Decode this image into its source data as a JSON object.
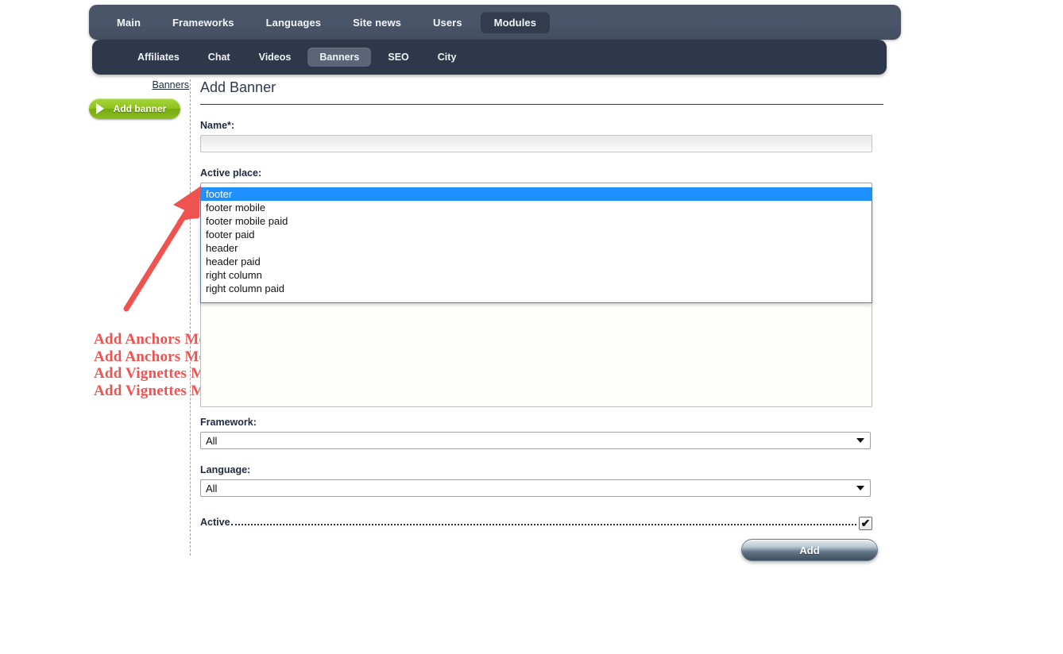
{
  "nav": {
    "primary": [
      {
        "label": "Main",
        "active": false
      },
      {
        "label": "Frameworks",
        "active": false
      },
      {
        "label": "Languages",
        "active": false
      },
      {
        "label": "Site news",
        "active": false
      },
      {
        "label": "Users",
        "active": false
      },
      {
        "label": "Modules",
        "active": true
      }
    ],
    "secondary": [
      {
        "label": "Affiliates",
        "active": false
      },
      {
        "label": "Chat",
        "active": false
      },
      {
        "label": "Videos",
        "active": false
      },
      {
        "label": "Banners",
        "active": true
      },
      {
        "label": "SEO",
        "active": false
      },
      {
        "label": "City",
        "active": false
      }
    ]
  },
  "sidebar": {
    "breadcrumb_label": "Banners",
    "add_banner_label": "Add banner",
    "add_banner_icon": "play-triangle-icon",
    "annotations": [
      "Add Anchors Mobil",
      "Add Anchors Mobil Paid",
      "Add Vignettes Mobil",
      "Add Vignettes Mobil Paid"
    ],
    "annotation_color": "#ef5350"
  },
  "main": {
    "title": "Add Banner",
    "name": {
      "label": "Name*:",
      "value": "",
      "placeholder": ""
    },
    "active_place": {
      "label": "Active place:",
      "selected": "footer",
      "caret_icon": "chevron-down-icon",
      "expanded": true,
      "options": [
        {
          "label": "footer",
          "selected": true
        },
        {
          "label": "footer mobile",
          "selected": false
        },
        {
          "label": "footer mobile paid",
          "selected": false
        },
        {
          "label": "footer paid",
          "selected": false
        },
        {
          "label": "header",
          "selected": false
        },
        {
          "label": "header paid",
          "selected": false
        },
        {
          "label": "right column",
          "selected": false
        },
        {
          "label": "right column paid",
          "selected": false
        }
      ],
      "highlight_color": "#1e90ff"
    },
    "content": {
      "value": ""
    },
    "framework": {
      "label": "Framework:",
      "selected": "All",
      "caret_icon": "chevron-down-icon"
    },
    "language": {
      "label": "Language:",
      "selected": "All",
      "caret_icon": "chevron-down-icon"
    },
    "active": {
      "label": "Active",
      "checked": true,
      "check_glyph": "✔"
    },
    "submit_label": "Add"
  },
  "theme": {
    "nav_primary_bg": "#4a5568",
    "nav_secondary_bg": "#2f384a",
    "accent_green": "#8ec31f",
    "label_color": "#1d2a44"
  }
}
